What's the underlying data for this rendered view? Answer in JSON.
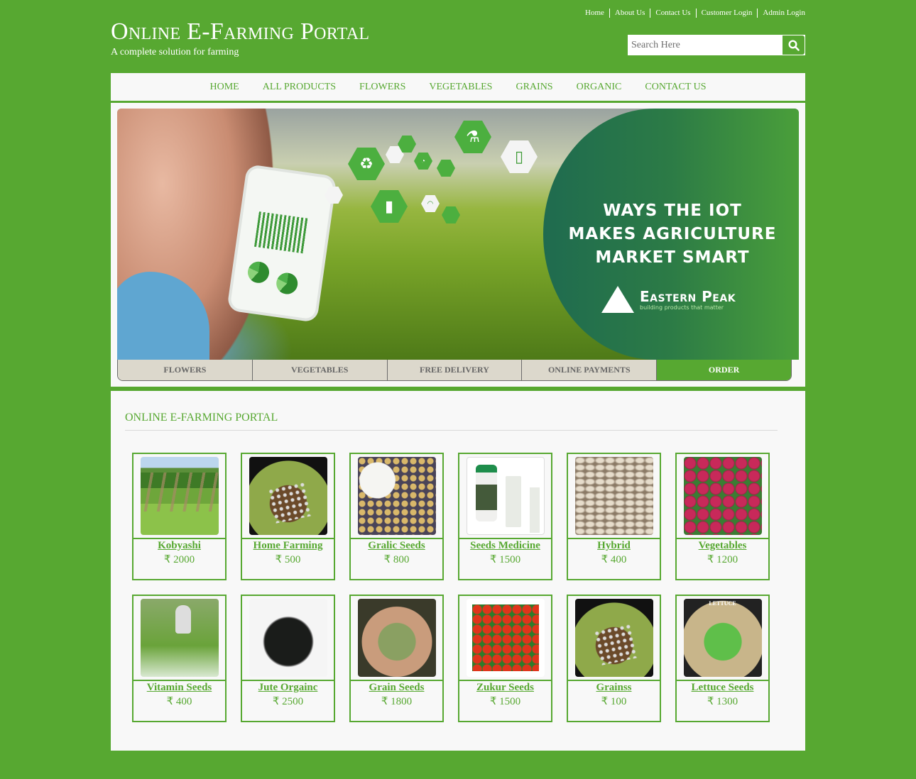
{
  "top_links": [
    "Home",
    "About Us",
    "Contact Us",
    "Customer Login",
    "Admin Login"
  ],
  "brand": {
    "title": "Online E-Farming Portal",
    "subtitle": "A complete solution for farming"
  },
  "search": {
    "placeholder": "Search Here",
    "value": "",
    "icon": "search-icon"
  },
  "nav": [
    "HOME",
    "ALL PRODUCTS",
    "FLOWERS",
    "VEGETABLES",
    "GRAINS",
    "ORGANIC",
    "CONTACT US"
  ],
  "banner": {
    "headline_lines": [
      "WAYS THE IOT",
      "MAKES AGRICULTURE",
      "MARKET SMART"
    ],
    "logo_name": "Eastern Peak",
    "logo_tagline": "building products that matter"
  },
  "slider_tabs": [
    {
      "label": "FLOWERS",
      "active": false
    },
    {
      "label": "VEGETABLES",
      "active": false
    },
    {
      "label": "FREE DELIVERY",
      "active": false
    },
    {
      "label": "ONLINE PAYMENTS",
      "active": false
    },
    {
      "label": "ORDER",
      "active": true
    }
  ],
  "products_section": {
    "title": "ONLINE E-FARMING PORTAL",
    "items": [
      {
        "name": "Kobyashi",
        "price": "₹ 2000",
        "image": "field-rows"
      },
      {
        "name": "Home Farming",
        "price": "₹ 500",
        "image": "seedling-tray"
      },
      {
        "name": "Gralic Seeds",
        "price": "₹ 800",
        "image": "garlic-seeds"
      },
      {
        "name": "Seeds Medicine",
        "price": "₹ 1500",
        "image": "medicine-bottles"
      },
      {
        "name": "Hybrid",
        "price": "₹ 400",
        "image": "pumpkin-seeds"
      },
      {
        "name": "Vegetables",
        "price": "₹ 1200",
        "image": "radishes"
      },
      {
        "name": "Vitamin Seeds",
        "price": "₹ 400",
        "image": "crop-spraying"
      },
      {
        "name": "Jute Orgainc",
        "price": "₹ 2500",
        "image": "black-seeds"
      },
      {
        "name": "Grain Seeds",
        "price": "₹ 1800",
        "image": "grains-in-hands"
      },
      {
        "name": "Zukur Seeds",
        "price": "₹ 1500",
        "image": "cherry-tomatoes"
      },
      {
        "name": "Grainss",
        "price": "₹ 100",
        "image": "seedling-tray"
      },
      {
        "name": "Lettuce Seeds",
        "price": "₹ 1300",
        "image": "lettuce-seed-packet"
      }
    ]
  },
  "colors": {
    "brand_green": "#57a831",
    "panel_bg": "#f8f8f8",
    "tab_bg": "#dcd8cc",
    "tab_text": "#666666"
  }
}
